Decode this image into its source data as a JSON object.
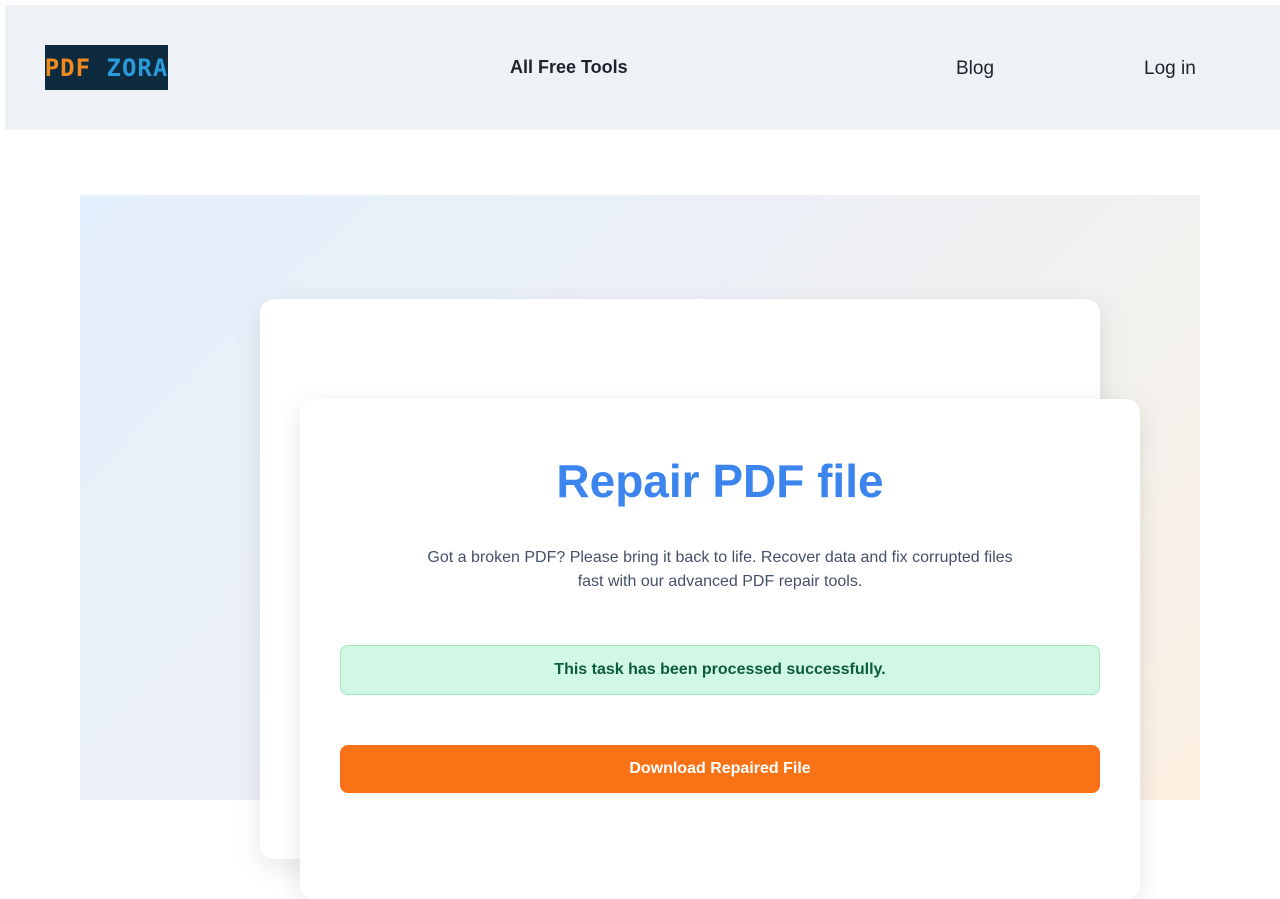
{
  "header": {
    "logo": {
      "part1": "PDF",
      "part2": "ZORA"
    },
    "nav": {
      "tools": "All Free Tools",
      "blog": "Blog",
      "login": "Log in"
    }
  },
  "main": {
    "title": "Repair PDF file",
    "description": "Got a broken PDF? Please bring it back to life. Recover data and fix corrupted files fast with our advanced PDF repair tools.",
    "status_message": "This task has been processed successfully.",
    "download_label": "Download Repaired File"
  },
  "colors": {
    "title": "#3d85ee",
    "success_bg": "#d1f8e5",
    "success_text": "#0d5c3c",
    "download_button": "#f97316",
    "header_bg": "#eef1f6"
  }
}
